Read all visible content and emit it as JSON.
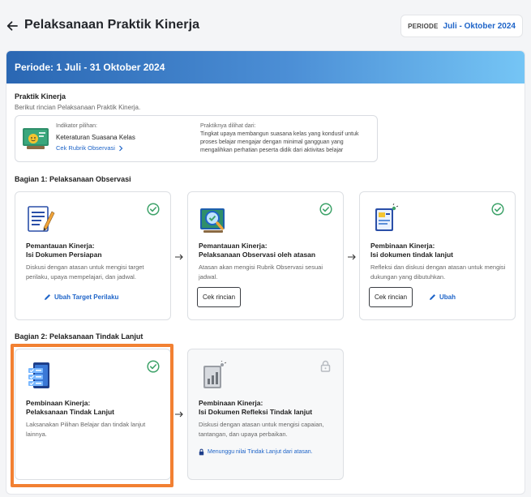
{
  "header": {
    "title": "Pelaksanaan Praktik Kinerja",
    "period_label": "PERIODE",
    "period_value": "Juli - Oktober 2024"
  },
  "banner": {
    "title": "Periode: 1 Juli - 31 Oktober 2024"
  },
  "praktik": {
    "title": "Praktik Kinerja",
    "subtitle": "Berikut rincian Pelaksanaan Praktik Kinerja.",
    "indicator_label": "Indikator pilihan:",
    "indicator_name": "Keteraturan Suasana Kelas",
    "rubric_link": "Cek Rubrik Observasi",
    "seen_label": "Praktiknya dilihat dari:",
    "seen_desc": "Tingkat upaya membangun suasana kelas yang kondusif untuk proses belajar mengajar dengan minimal gangguan yang mengalihkan perhatian peserta didik dari aktivitas belajar"
  },
  "section1": {
    "title": "Bagian 1: Pelaksanaan Observasi",
    "cards": [
      {
        "title1": "Pemantauan Kinerja:",
        "title2": "Isi Dokumen Persiapan",
        "desc": "Diskusi dengan atasan untuk mengisi target perilaku, upaya mempelajari, dan jadwal.",
        "link": "Ubah Target Perilaku"
      },
      {
        "title1": "Pemantauan Kinerja:",
        "title2": "Pelaksanaan Observasi oleh atasan",
        "desc": "Atasan akan mengisi Rubrik Observasi sesuai jadwal.",
        "button": "Cek rincian"
      },
      {
        "title1": "Pembinaan Kinerja:",
        "title2": "Isi dokumen tindak lanjut",
        "desc": "Refleksi dan diskusi dengan atasan untuk mengisi dukungan yang dibutuhkan.",
        "button": "Cek rincian",
        "link": "Ubah"
      }
    ]
  },
  "section2": {
    "title": "Bagian 2: Pelaksanaan Tindak Lanjut",
    "cards": [
      {
        "title1": "Pembinaan Kinerja:",
        "title2": "Pelaksanaan Tindak Lanjut",
        "desc": "Laksanakan Pilihan Belajar dan tindak lanjut lainnya."
      },
      {
        "title1": "Pembinaan Kinerja:",
        "title2": "Isi Dokumen Refleksi Tindak lanjut",
        "desc": "Diskusi dengan atasan untuk mengisi capaian, tantangan, dan upaya perbaikan.",
        "note": "Menunggu nilai Tindak Lanjut dari atasan."
      }
    ]
  },
  "colors": {
    "accent": "#1e64c8",
    "success": "#3fa36a",
    "highlight": "#f28032"
  }
}
